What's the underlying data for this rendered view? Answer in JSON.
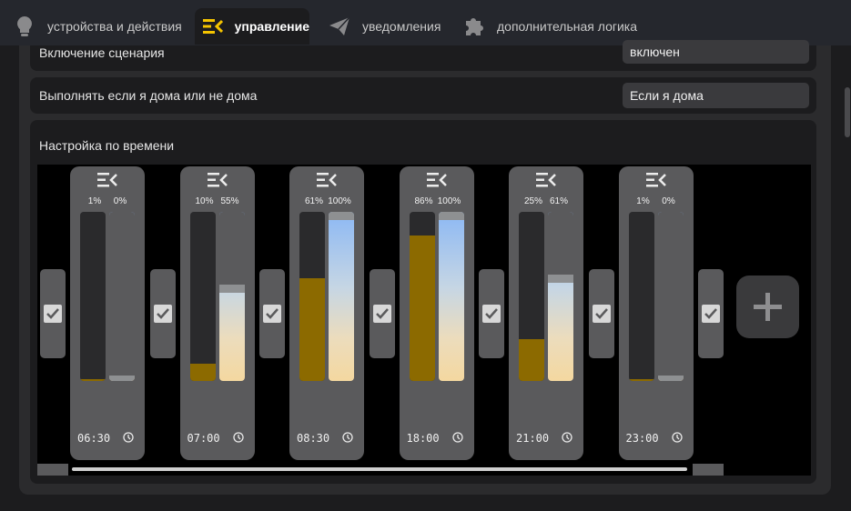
{
  "nav": {
    "tabs": [
      {
        "label": "устройства и действия",
        "icon": "lightbulb-icon",
        "active": false
      },
      {
        "label": "управление",
        "icon": "control-menu-icon",
        "active": true
      },
      {
        "label": "уведомления",
        "icon": "paper-plane-icon",
        "active": false
      },
      {
        "label": "дополнительная логика",
        "icon": "puzzle-icon",
        "active": false
      }
    ]
  },
  "settings": {
    "scenario_label": "Включение сценария",
    "scenario_value": "включен",
    "presence_label": "Выполнять если я дома или не дома",
    "presence_value": "Если я дома"
  },
  "schedule": {
    "title": "Настройка по времени",
    "points": [
      {
        "time": "06:30",
        "brightness_label": "1%",
        "temperature_label": "0%",
        "brightness": 1,
        "temperature": 0,
        "enabled": true
      },
      {
        "time": "07:00",
        "brightness_label": "10%",
        "temperature_label": "55%",
        "brightness": 10,
        "temperature": 55,
        "enabled": true
      },
      {
        "time": "08:30",
        "brightness_label": "61%",
        "temperature_label": "100%",
        "brightness": 61,
        "temperature": 100,
        "enabled": true
      },
      {
        "time": "18:00",
        "brightness_label": "86%",
        "temperature_label": "100%",
        "brightness": 86,
        "temperature": 100,
        "enabled": true
      },
      {
        "time": "21:00",
        "brightness_label": "25%",
        "temperature_label": "61%",
        "brightness": 25,
        "temperature": 61,
        "enabled": true
      },
      {
        "time": "23:00",
        "brightness_label": "1%",
        "temperature_label": "0%",
        "brightness": 1,
        "temperature": 0,
        "enabled": true
      }
    ],
    "trailing_checkbox_enabled": true,
    "add_icon": "plus-icon"
  },
  "colors": {
    "brightness_fill": "#8c6a00",
    "accent": "#f5c400",
    "panel": "#2b2b2d"
  }
}
